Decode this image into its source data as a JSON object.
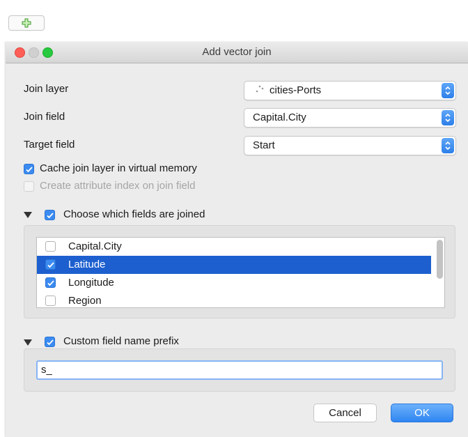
{
  "toolbar": {
    "add_icon": "plus-icon"
  },
  "window": {
    "title": "Add vector join"
  },
  "colors": {
    "accent": "#3b8bf0",
    "selection": "#1d5fcf",
    "close": "#ff5f57",
    "zoom": "#27c93f"
  },
  "form": {
    "join_layer": {
      "label": "Join layer",
      "value": "cities-Ports",
      "icon": "point-layer-icon"
    },
    "join_field": {
      "label": "Join field",
      "value": "Capital.City"
    },
    "target_field": {
      "label": "Target field",
      "value": "Start"
    },
    "cache_join": {
      "label": "Cache join layer in virtual memory",
      "checked": true
    },
    "attr_index": {
      "label": "Create attribute index on join field",
      "checked": false,
      "enabled": false
    }
  },
  "fields_group": {
    "title": "Choose which fields are joined",
    "checked": true,
    "items": [
      {
        "label": "Capital.City",
        "checked": false,
        "selected": false
      },
      {
        "label": "Latitude",
        "checked": true,
        "selected": true
      },
      {
        "label": "Longitude",
        "checked": true,
        "selected": false
      },
      {
        "label": "Region",
        "checked": false,
        "selected": false
      }
    ]
  },
  "prefix_group": {
    "title": "Custom field name prefix",
    "checked": true,
    "value": "s_"
  },
  "buttons": {
    "cancel": "Cancel",
    "ok": "OK"
  }
}
